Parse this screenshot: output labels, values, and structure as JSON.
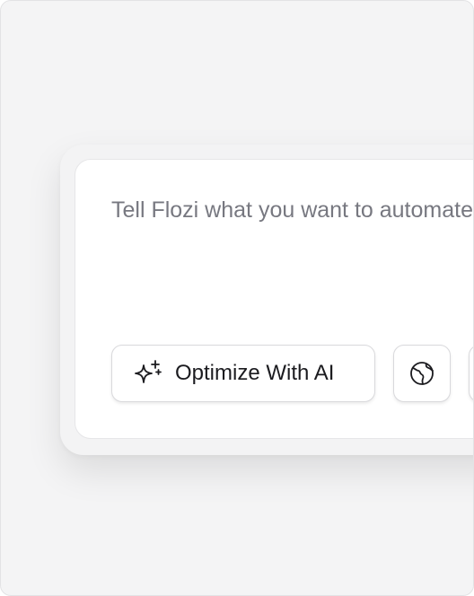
{
  "prompt": {
    "placeholder": "Tell Flozi what you want to automate"
  },
  "toolbar": {
    "optimize_label": "Optimize With AI",
    "optimize_icon": "sparkle-icon",
    "globe_icon": "globe-icon"
  }
}
